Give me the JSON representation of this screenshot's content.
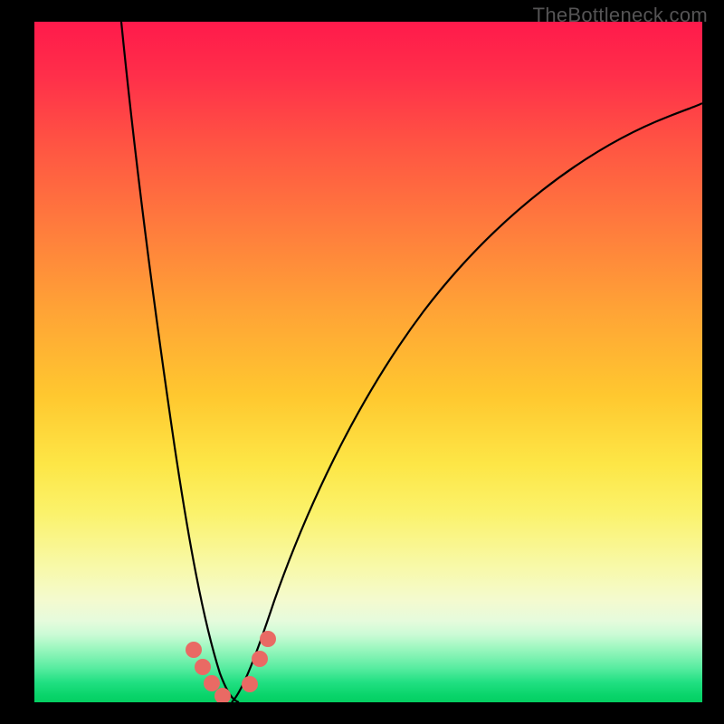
{
  "watermark": "TheBottleneck.com",
  "chart_data": {
    "type": "line",
    "title": "",
    "xlabel": "",
    "ylabel": "",
    "xlim": [
      0,
      1
    ],
    "ylim": [
      0,
      1
    ],
    "background_gradient": {
      "top": "#ff1a4b",
      "mid": "#ffc82f",
      "bottom": "#04cf62"
    },
    "series": [
      {
        "name": "left-branch",
        "x": [
          0.13,
          0.16,
          0.19,
          0.215,
          0.235,
          0.255,
          0.27,
          0.283,
          0.295
        ],
        "values": [
          1.0,
          0.72,
          0.48,
          0.3,
          0.18,
          0.09,
          0.04,
          0.015,
          0.0
        ]
      },
      {
        "name": "right-branch",
        "x": [
          0.295,
          0.33,
          0.38,
          0.45,
          0.54,
          0.66,
          0.8,
          0.92,
          1.0
        ],
        "values": [
          0.0,
          0.08,
          0.22,
          0.38,
          0.52,
          0.65,
          0.76,
          0.83,
          0.87
        ]
      }
    ],
    "markers": [
      {
        "x": 0.23,
        "y": 0.072
      },
      {
        "x": 0.246,
        "y": 0.045
      },
      {
        "x": 0.258,
        "y": 0.022
      },
      {
        "x": 0.272,
        "y": 0.006
      },
      {
        "x": 0.31,
        "y": 0.02
      },
      {
        "x": 0.328,
        "y": 0.06
      },
      {
        "x": 0.34,
        "y": 0.09
      }
    ],
    "marker_radius_px": 9,
    "colors": {
      "curve": "#000000",
      "markers": "#e96a64"
    }
  }
}
